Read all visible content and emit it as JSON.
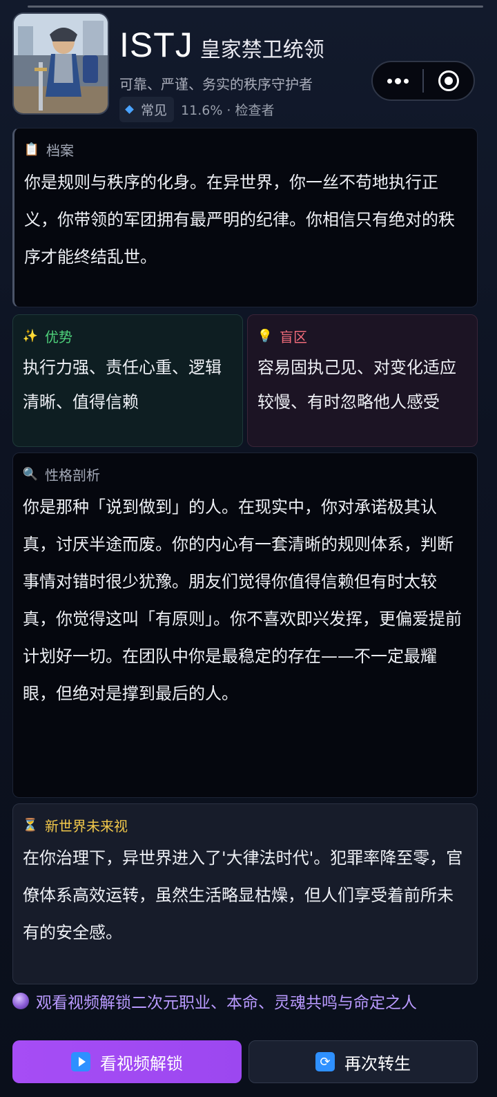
{
  "header": {
    "mbti": "ISTJ",
    "role": "皇家禁卫统领",
    "subtitle": "可靠、严谨、务实的秩序守护者",
    "rarity": "常见",
    "meta_text": "11.6% · 检查者"
  },
  "archive": {
    "icon": "clipboard-icon",
    "title": "档案",
    "body": "你是规则与秩序的化身。在异世界，你一丝不苟地执行正义，你带领的军团拥有最严明的纪律。你相信只有绝对的秩序才能终结乱世。"
  },
  "strength": {
    "icon": "sparkles-icon",
    "title": "优势",
    "body": "执行力强、责任心重、逻辑清晰、值得信赖",
    "color": "#4ed17a"
  },
  "blind": {
    "icon": "lightbulb-icon",
    "title": "盲区",
    "body": "容易固执己见、对变化适应较慢、有时忽略他人感受",
    "color": "#f06b7a"
  },
  "analysis": {
    "icon": "magnifier-icon",
    "title": "性格剖析",
    "body": "你是那种「说到做到」的人。在现实中，你对承诺极其认真，讨厌半途而废。你的内心有一套清晰的规则体系，判断事情对错时很少犹豫。朋友们觉得你值得信赖但有时太较真，你觉得这叫「有原则」。你不喜欢即兴发挥，更偏爱提前计划好一切。在团队中你是最稳定的存在——不一定最耀眼，但绝对是撑到最后的人。"
  },
  "future": {
    "icon": "hourglass-icon",
    "title": "新世界未来视",
    "body": "在你治理下，异世界进入了'大律法时代'。犯罪率降至零，官僚体系高效运转，虽然生活略显枯燥，但人们享受着前所未有的安全感。",
    "color": "#f2c84b"
  },
  "unlock_tip": "观看视频解锁二次元职业、本命、灵魂共鸣与命定之人",
  "buttons": {
    "watch": "看视频解锁",
    "reborn": "再次转生"
  },
  "accent": "#a64df5"
}
